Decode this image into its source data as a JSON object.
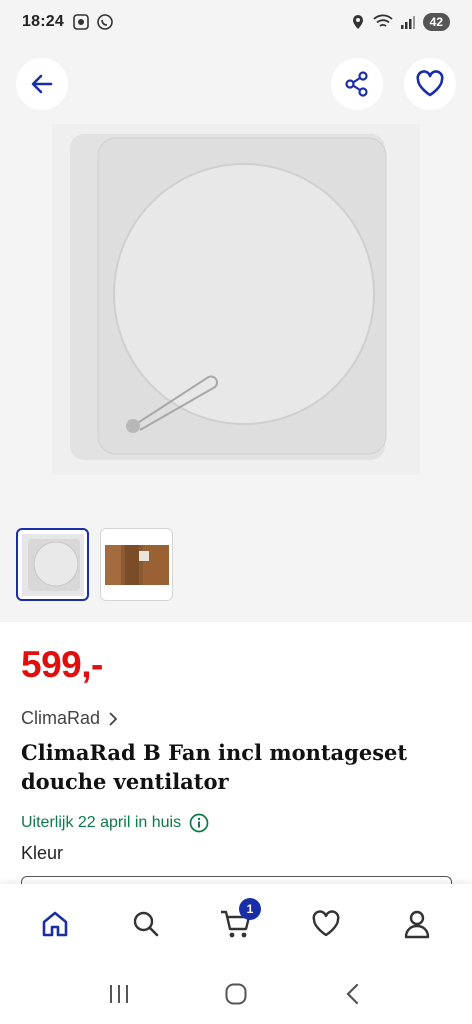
{
  "status_bar": {
    "time": "18:24",
    "battery": "42",
    "icons": [
      "screenshot-icon",
      "whatsapp-icon",
      "location-icon",
      "wifi-icon",
      "signal-icon"
    ]
  },
  "gallery": {
    "back_icon": "arrow-left-icon",
    "share_icon": "share-icon",
    "favorite_icon": "heart-icon",
    "thumbnails": [
      "thumbnail-fan",
      "thumbnail-installation"
    ],
    "selected_thumbnail": 0
  },
  "product": {
    "price": "599,-",
    "brand": "ClimaRad",
    "title": "ClimaRad B Fan incl montageset douche ventilator",
    "delivery": "Uiterlijk 22 april in huis",
    "color_label": "Kleur"
  },
  "bottom_nav": {
    "items": [
      "home-icon",
      "search-icon",
      "cart-icon",
      "heart-icon",
      "account-icon"
    ],
    "active": "home-icon",
    "cart_count": "1"
  },
  "colors": {
    "accent": "#1a2ea8",
    "price": "#e10e0e",
    "delivery": "#0c7a4a"
  }
}
